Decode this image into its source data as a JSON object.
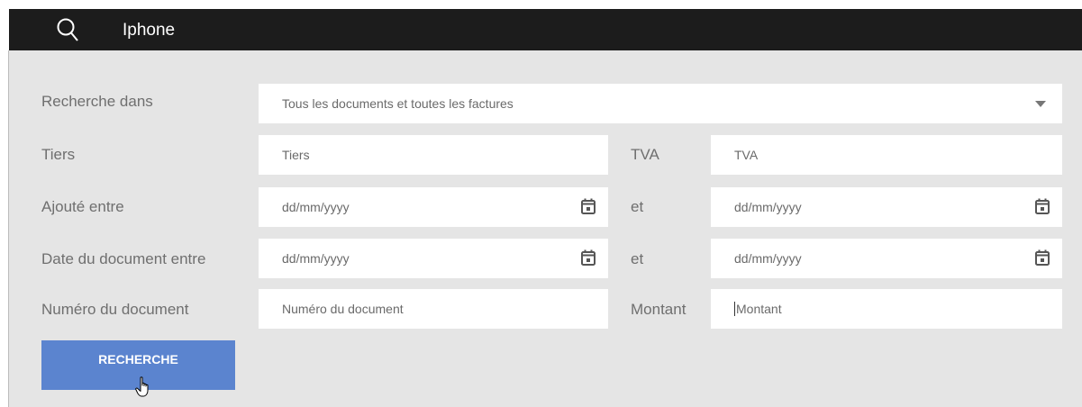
{
  "header": {
    "query": "Iphone"
  },
  "form": {
    "scope": {
      "label": "Recherche dans",
      "value": "Tous les documents et toutes les factures"
    },
    "tiers": {
      "label": "Tiers",
      "placeholder": "Tiers"
    },
    "tva": {
      "label": "TVA",
      "placeholder": "TVA"
    },
    "added_between": {
      "label": "Ajouté entre",
      "from_placeholder": "dd/mm/yyyy",
      "and_label": "et",
      "to_placeholder": "dd/mm/yyyy"
    },
    "document_date_between": {
      "label": "Date du document entre",
      "from_placeholder": "dd/mm/yyyy",
      "and_label": "et",
      "to_placeholder": "dd/mm/yyyy"
    },
    "document_number": {
      "label": "Numéro du document",
      "placeholder": "Numéro du document"
    },
    "amount": {
      "label": "Montant",
      "placeholder": "Montant"
    },
    "submit_label": "RECHERCHE"
  },
  "icons": {
    "search": "search-icon",
    "calendar": "calendar-icon",
    "dropdown": "chevron-down-icon",
    "cursor": "hand-pointer-icon"
  },
  "colors": {
    "topbar": "#1c1c1c",
    "panel": "#e5e5e5",
    "button": "#5b84cf"
  }
}
